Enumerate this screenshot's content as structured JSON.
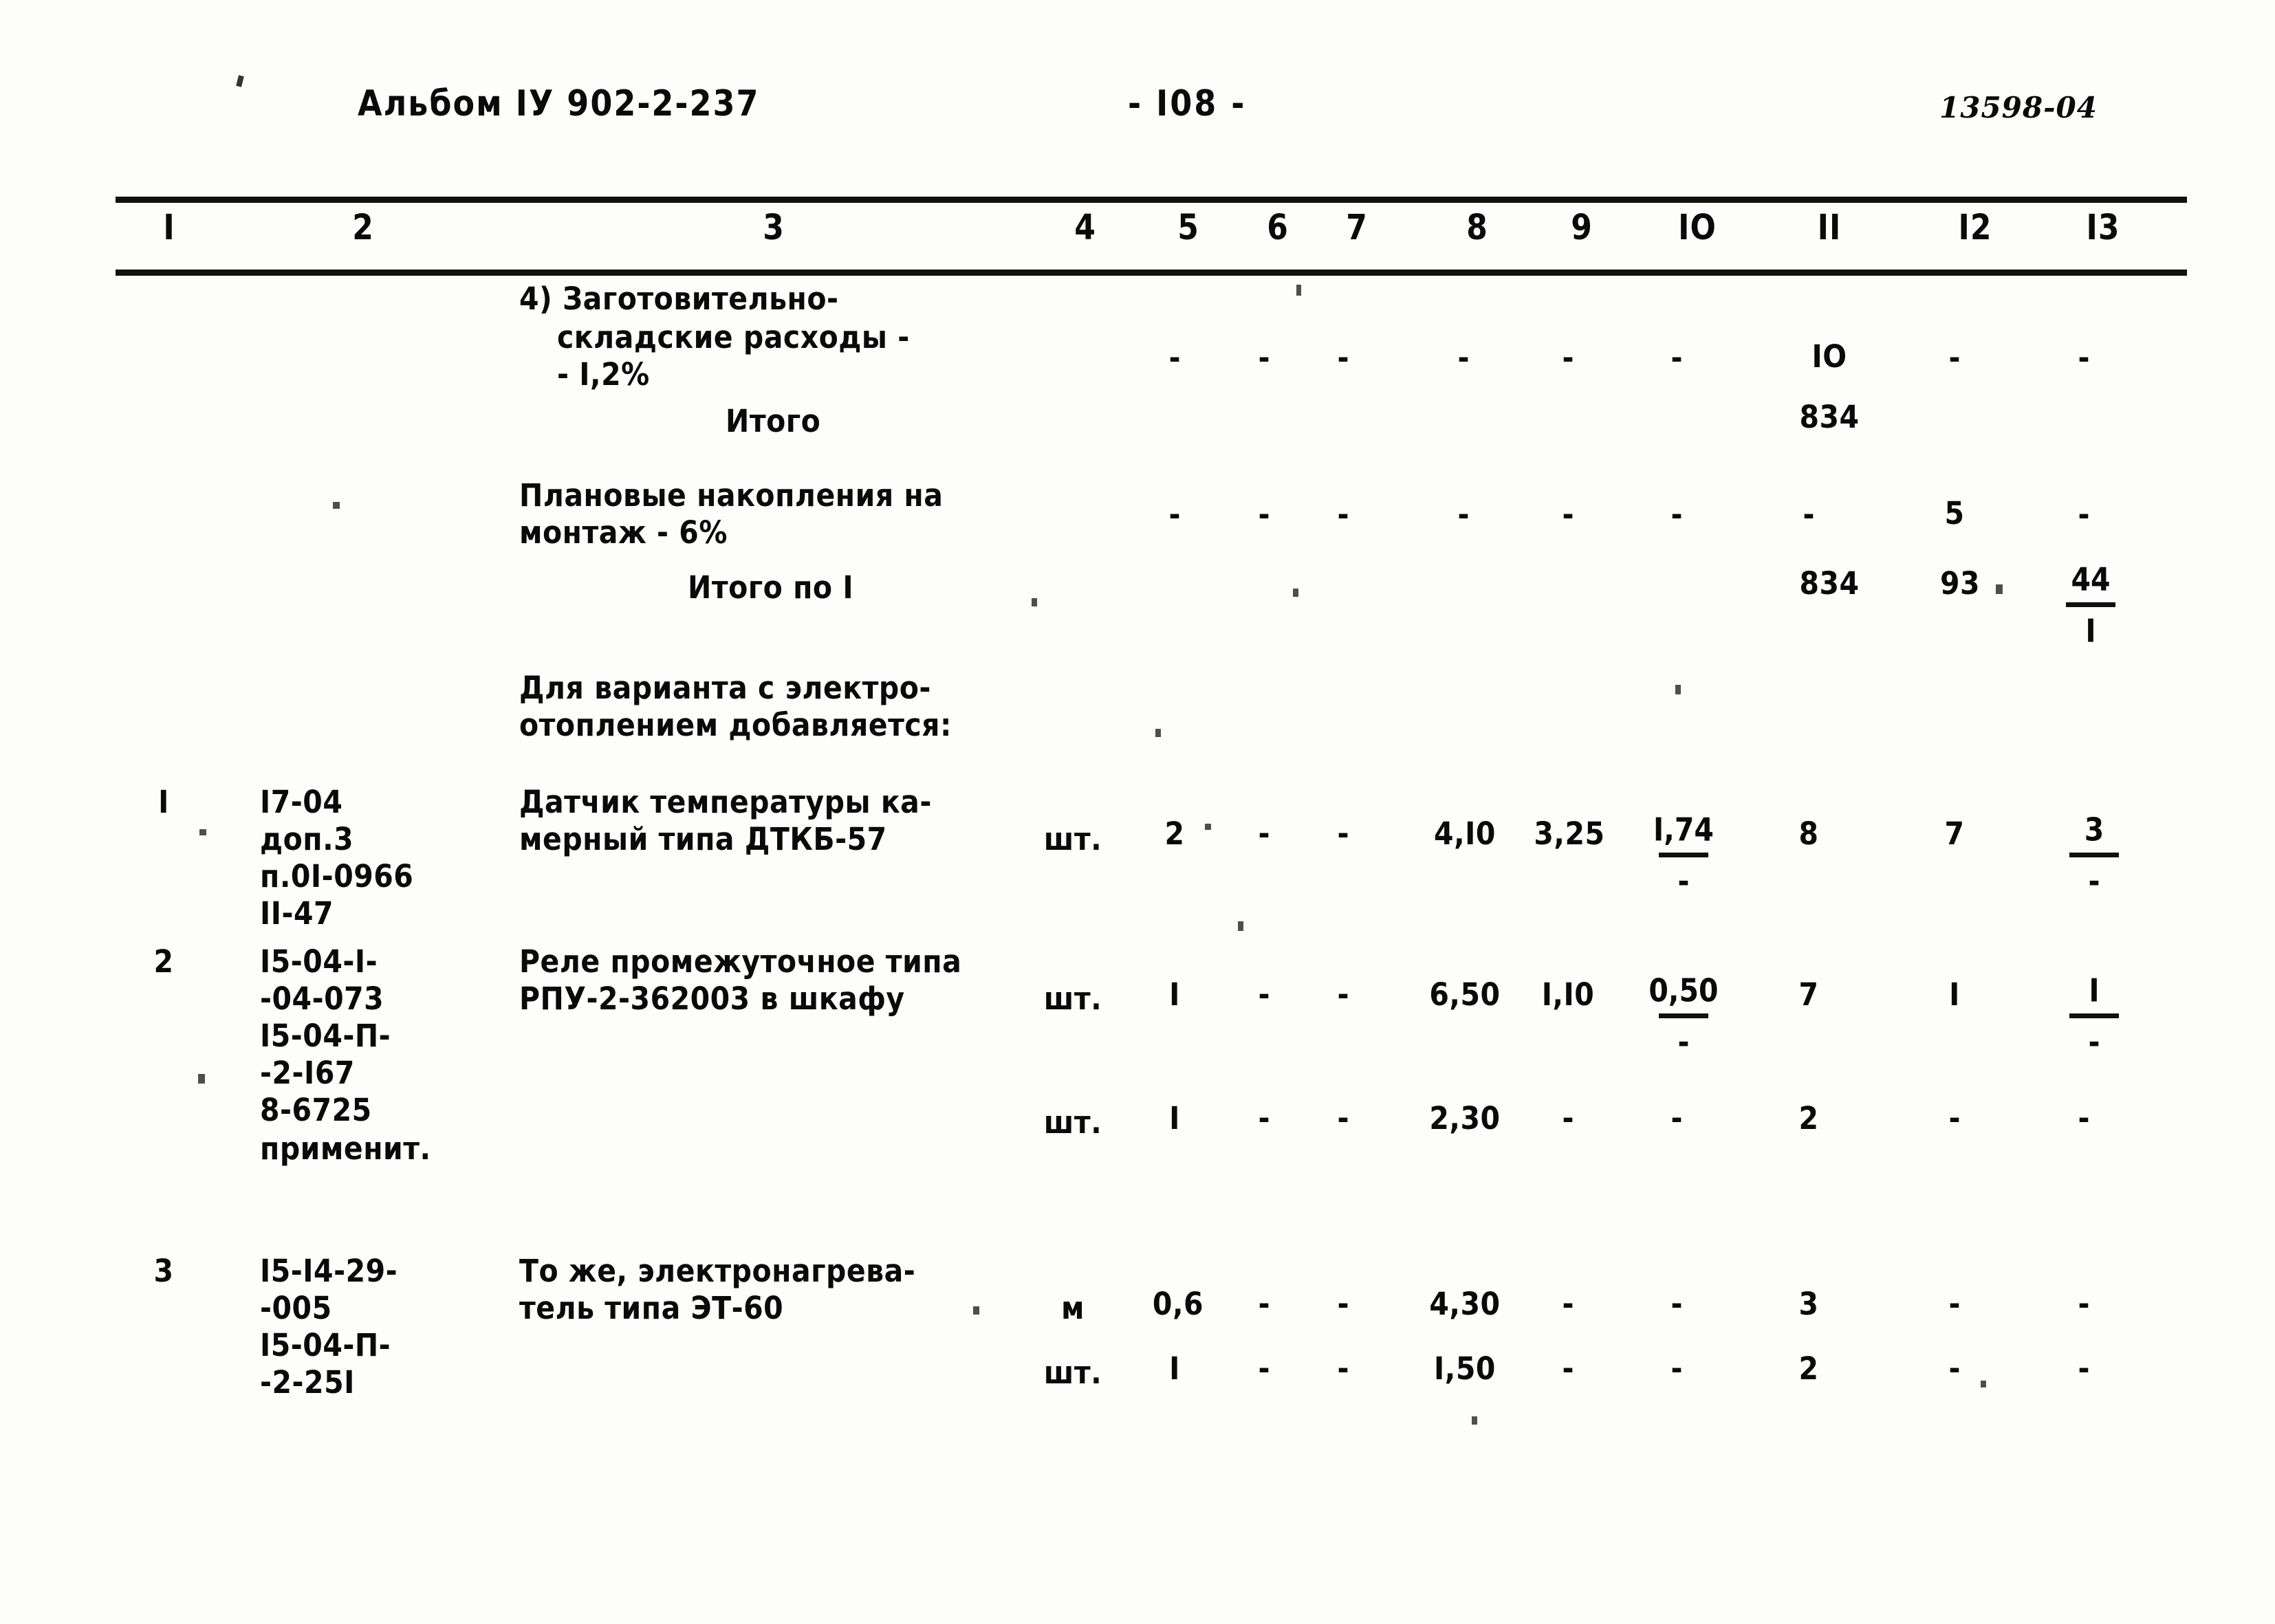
{
  "header": {
    "album": "Альбом IУ 902-2-237",
    "page_number": "- I08 -",
    "doc_code": "13598-04"
  },
  "column_numbers": [
    "I",
    "2",
    "3",
    "4",
    "5",
    "6",
    "7",
    "8",
    "9",
    "IO",
    "II",
    "I2",
    "I3"
  ],
  "rows": [
    {
      "id": "zagotovitelno-skladskie",
      "num": "",
      "code": "",
      "desc_lines": [
        "4) Заготовительно-",
        "складские расходы -",
        "- I,2%"
      ],
      "unit": "",
      "c5": "-",
      "c6": "-",
      "c7": "-",
      "c8": "-",
      "c9": "-",
      "c10": "-",
      "c11": "IO",
      "c12": "-",
      "c13": "-"
    },
    {
      "id": "itogo",
      "num": "",
      "code": "",
      "desc_lines": [
        "Итого"
      ],
      "unit": "",
      "c5": "",
      "c6": "",
      "c7": "",
      "c8": "",
      "c9": "",
      "c10": "",
      "c11": "834",
      "c12": "",
      "c13": ""
    },
    {
      "id": "planovye-nakopleniya",
      "num": "",
      "code": "",
      "desc_lines": [
        "Плановые накопления на",
        "монтаж - 6%"
      ],
      "unit": "",
      "c5": "-",
      "c6": "-",
      "c7": "-",
      "c8": "-",
      "c9": "-",
      "c10": "-",
      "c11": "-",
      "c12": "5",
      "c13": "-"
    },
    {
      "id": "itogo-po-1",
      "num": "",
      "code": "",
      "desc_lines": [
        "Итого по I"
      ],
      "unit": "",
      "c5": "",
      "c6": "",
      "c7": "",
      "c8": "",
      "c9": "",
      "c10": "",
      "c11": "834",
      "c12": "93",
      "c13_fraction": {
        "numerator": "44",
        "denominator": "I"
      }
    },
    {
      "id": "note-electro",
      "num": "",
      "code": "",
      "desc_lines": [
        "Для варианта с электро-",
        "отоплением добавляется:"
      ],
      "unit": ""
    },
    {
      "id": "datchik-temperatury",
      "num": "I",
      "code_lines": [
        "I7-04",
        "доп.3",
        "п.0I-0966",
        "II-47"
      ],
      "desc_lines": [
        "Датчик температуры ка-",
        "мерный типа ДТКБ-57"
      ],
      "unit": "шт.",
      "c5": "2",
      "c6": "-",
      "c7": "-",
      "c8": "4,I0",
      "c9": "3,25",
      "c10_fraction": {
        "numerator": "I,74",
        "denominator": "-"
      },
      "c11": "8",
      "c12": "7",
      "c13_fraction": {
        "numerator": "3",
        "denominator": "-"
      }
    },
    {
      "id": "rele-promezhutochnoe",
      "num": "2",
      "code_lines": [
        "I5-04-I-",
        "-04-073",
        "I5-04-П-",
        "-2-I67",
        "8-6725",
        "применит."
      ],
      "desc_lines": [
        "Реле промежуточное типа",
        "РПУ-2-362003 в шкафу"
      ],
      "unit": "шт.",
      "c5": "I",
      "c6": "-",
      "c7": "-",
      "c8": "6,50",
      "c9": "I,I0",
      "c10_fraction": {
        "numerator": "0,50",
        "denominator": "-"
      },
      "c11": "7",
      "c12": "I",
      "c13_fraction": {
        "numerator": "I",
        "denominator": "-"
      }
    },
    {
      "id": "rele-promezhutochnoe-sub",
      "num": "",
      "code": "",
      "desc_lines": [],
      "unit": "шт.",
      "c5": "I",
      "c6": "-",
      "c7": "-",
      "c8": "2,30",
      "c9": "-",
      "c10": "-",
      "c11": "2",
      "c12": "-",
      "c13": "-"
    },
    {
      "id": "elektronagrevatel",
      "num": "3",
      "code_lines": [
        "I5-I4-29-",
        "-005",
        "I5-04-П-",
        "-2-25I"
      ],
      "desc_lines": [
        "То же, электронагрева-",
        "тель типа ЭТ-60"
      ],
      "unit": "м",
      "c5": "0,6",
      "c6": "-",
      "c7": "-",
      "c8": "4,30",
      "c9": "-",
      "c10": "-",
      "c11": "3",
      "c12": "-",
      "c13": "-"
    },
    {
      "id": "elektronagrevatel-sub",
      "num": "",
      "code": "",
      "desc_lines": [],
      "unit": "шт.",
      "c5": "I",
      "c6": "-",
      "c7": "-",
      "c8": "I,50",
      "c9": "-",
      "c10": "-",
      "c11": "2",
      "c12": "-",
      "c13": "-"
    }
  ]
}
